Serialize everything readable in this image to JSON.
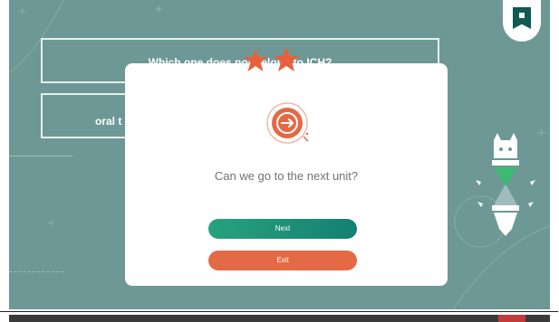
{
  "question": {
    "text": "Which one does not belong to ICH?",
    "options": [
      "oral t"
    ]
  },
  "dialog": {
    "prompt": "Can we go to the next unit?",
    "next_label": "Next",
    "exit_label": "Exit",
    "stars_shown": 2
  },
  "colors": {
    "background": "#6d9895",
    "next_button": "#1f9577",
    "exit_button": "#e36a45",
    "star": "#e8603c",
    "bookmark": "#0f5a52"
  },
  "icons": [
    "star-icon",
    "unit-exit-icon",
    "bookmark-icon",
    "hourglass-mascot-icon"
  ]
}
